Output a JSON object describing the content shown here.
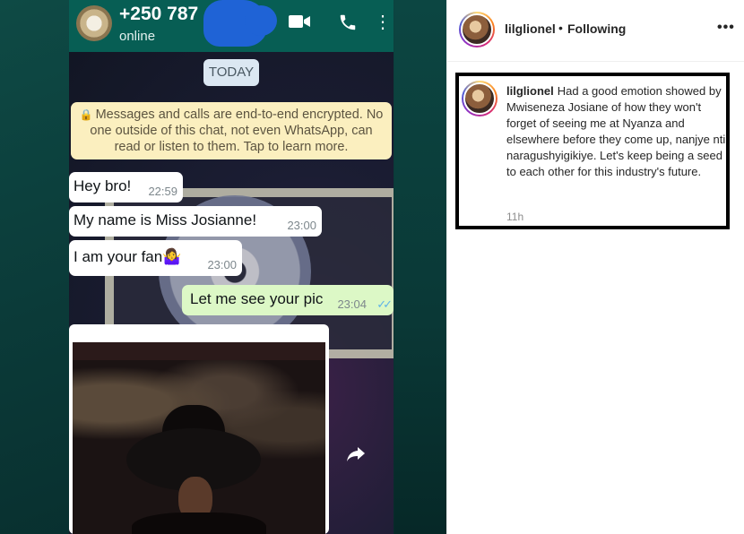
{
  "whatsapp": {
    "contact_number": "+250 787",
    "status": "online",
    "date_chip": "TODAY",
    "encryption_note": "Messages and calls are end-to-end encrypted. No one outside of this chat, not even WhatsApp, can read or listen to them. Tap to learn more.",
    "messages": [
      {
        "text": "Hey bro!",
        "time": "22:59",
        "direction": "incoming"
      },
      {
        "text": "My name is Miss Josianne!",
        "time": "23:00",
        "direction": "incoming"
      },
      {
        "text": "I am your fan🤷‍♀️",
        "time": "23:00",
        "direction": "incoming"
      },
      {
        "text": "Let me see your pic",
        "time": "23:04",
        "direction": "outgoing",
        "ticks": "✓✓"
      }
    ],
    "icons": {
      "video": "video-call-icon",
      "call": "phone-call-icon",
      "forward": "forward-icon",
      "lock": "lock-icon"
    },
    "colors": {
      "header": "#075e54",
      "outgoing_bubble": "#dcf8c6",
      "incoming_bubble": "#ffffff",
      "encryption_note": "#fbefbf"
    }
  },
  "instagram": {
    "header": {
      "username": "lilglionel",
      "separator": "•",
      "follow_status": "Following",
      "more_label": "•••"
    },
    "caption": {
      "username": "lilglionel",
      "text": "Had a good emotion showed by Mwiseneza Josiane of how they won't forget of seeing me at Nyanza and elsewhere before they come up, nanjye nti naragushyigikiye. Let's keep being a seed to each other for this industry's future.",
      "time": "11h"
    }
  }
}
